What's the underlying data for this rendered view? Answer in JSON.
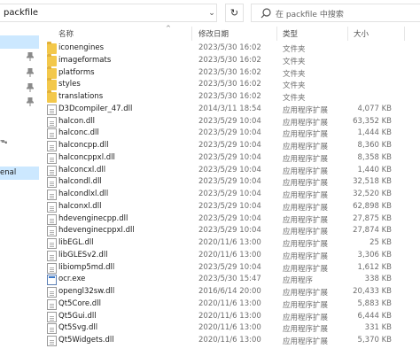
{
  "address": {
    "path": "packfile"
  },
  "search": {
    "placeholder": "在 packfile 中搜索"
  },
  "nav": {
    "items": [
      {
        "label": "",
        "selected": true
      },
      {
        "label": ""
      },
      {
        "label": ""
      },
      {
        "label": ""
      },
      {
        "label": ""
      },
      {
        "label": ""
      },
      {
        "label": "ᯓ"
      },
      {
        "label": ""
      },
      {
        "label": ""
      },
      {
        "label": "enal",
        "selected": true
      }
    ]
  },
  "columns": {
    "name": "名称",
    "date": "修改日期",
    "type": "类型",
    "size": "大小"
  },
  "files": [
    {
      "name": "iconengines",
      "date": "2023/5/30 16:02",
      "type": "文件夹",
      "size": "",
      "icon": "folder-icon"
    },
    {
      "name": "imageformats",
      "date": "2023/5/30 16:02",
      "type": "文件夹",
      "size": "",
      "icon": "folder-icon"
    },
    {
      "name": "platforms",
      "date": "2023/5/30 16:02",
      "type": "文件夹",
      "size": "",
      "icon": "folder-icon"
    },
    {
      "name": "styles",
      "date": "2023/5/30 16:02",
      "type": "文件夹",
      "size": "",
      "icon": "folder-icon"
    },
    {
      "name": "translations",
      "date": "2023/5/30 16:02",
      "type": "文件夹",
      "size": "",
      "icon": "folder-icon"
    },
    {
      "name": "D3Dcompiler_47.dll",
      "date": "2014/3/11 18:54",
      "type": "应用程序扩展",
      "size": "4,077 KB",
      "icon": "dll-file-icon"
    },
    {
      "name": "halcon.dll",
      "date": "2023/5/29 10:04",
      "type": "应用程序扩展",
      "size": "63,352 KB",
      "icon": "dll-file-icon"
    },
    {
      "name": "halconc.dll",
      "date": "2023/5/29 10:04",
      "type": "应用程序扩展",
      "size": "1,444 KB",
      "icon": "dll-file-icon"
    },
    {
      "name": "halconcpp.dll",
      "date": "2023/5/29 10:04",
      "type": "应用程序扩展",
      "size": "8,360 KB",
      "icon": "dll-file-icon"
    },
    {
      "name": "halconcppxl.dll",
      "date": "2023/5/29 10:04",
      "type": "应用程序扩展",
      "size": "8,358 KB",
      "icon": "dll-file-icon"
    },
    {
      "name": "halconcxl.dll",
      "date": "2023/5/29 10:04",
      "type": "应用程序扩展",
      "size": "1,440 KB",
      "icon": "dll-file-icon"
    },
    {
      "name": "halcondl.dll",
      "date": "2023/5/29 10:04",
      "type": "应用程序扩展",
      "size": "32,518 KB",
      "icon": "dll-file-icon"
    },
    {
      "name": "halcondlxl.dll",
      "date": "2023/5/29 10:04",
      "type": "应用程序扩展",
      "size": "32,520 KB",
      "icon": "dll-file-icon"
    },
    {
      "name": "halconxl.dll",
      "date": "2023/5/29 10:04",
      "type": "应用程序扩展",
      "size": "62,898 KB",
      "icon": "dll-file-icon"
    },
    {
      "name": "hdevenginecpp.dll",
      "date": "2023/5/29 10:04",
      "type": "应用程序扩展",
      "size": "27,875 KB",
      "icon": "dll-file-icon"
    },
    {
      "name": "hdevenginecppxl.dll",
      "date": "2023/5/29 10:04",
      "type": "应用程序扩展",
      "size": "27,874 KB",
      "icon": "dll-file-icon"
    },
    {
      "name": "libEGL.dll",
      "date": "2020/11/6 13:00",
      "type": "应用程序扩展",
      "size": "25 KB",
      "icon": "dll-file-icon"
    },
    {
      "name": "libGLESv2.dll",
      "date": "2020/11/6 13:00",
      "type": "应用程序扩展",
      "size": "3,306 KB",
      "icon": "dll-file-icon"
    },
    {
      "name": "libiomp5md.dll",
      "date": "2023/5/29 10:04",
      "type": "应用程序扩展",
      "size": "1,612 KB",
      "icon": "dll-file-icon"
    },
    {
      "name": "ocr.exe",
      "date": "2023/5/30 15:47",
      "type": "应用程序",
      "size": "338 KB",
      "icon": "exe-file-icon"
    },
    {
      "name": "opengl32sw.dll",
      "date": "2016/6/14 20:00",
      "type": "应用程序扩展",
      "size": "20,433 KB",
      "icon": "dll-file-icon"
    },
    {
      "name": "Qt5Core.dll",
      "date": "2020/11/6 13:00",
      "type": "应用程序扩展",
      "size": "5,883 KB",
      "icon": "dll-file-icon"
    },
    {
      "name": "Qt5Gui.dll",
      "date": "2020/11/6 13:00",
      "type": "应用程序扩展",
      "size": "6,444 KB",
      "icon": "dll-file-icon"
    },
    {
      "name": "Qt5Svg.dll",
      "date": "2020/11/6 13:00",
      "type": "应用程序扩展",
      "size": "331 KB",
      "icon": "dll-file-icon"
    },
    {
      "name": "Qt5Widgets.dll",
      "date": "2020/11/6 13:00",
      "type": "应用程序扩展",
      "size": "5,370 KB",
      "icon": "dll-file-icon"
    }
  ]
}
